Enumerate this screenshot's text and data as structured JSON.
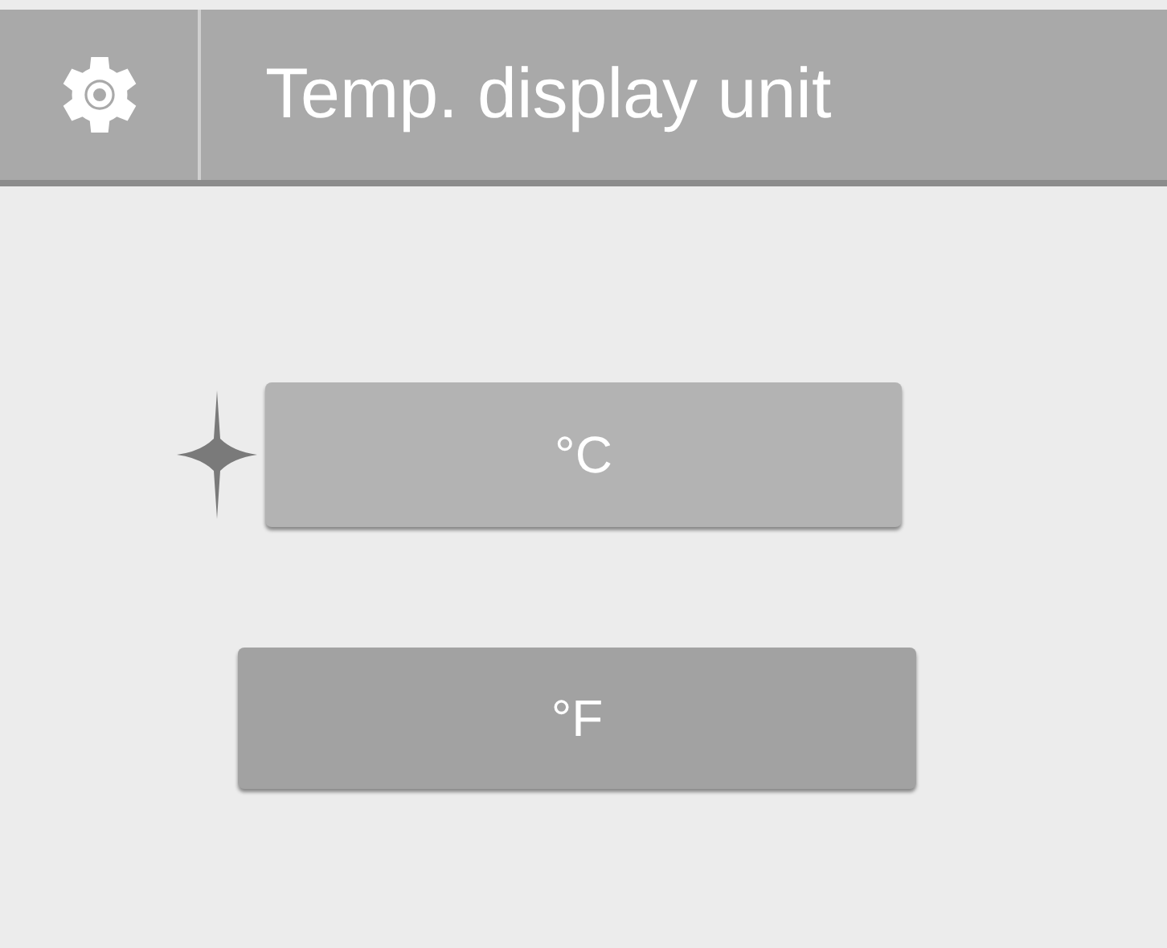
{
  "header": {
    "title": "Temp. display unit"
  },
  "options": [
    {
      "label": "°C",
      "selected": true
    },
    {
      "label": "°F",
      "selected": false
    }
  ]
}
